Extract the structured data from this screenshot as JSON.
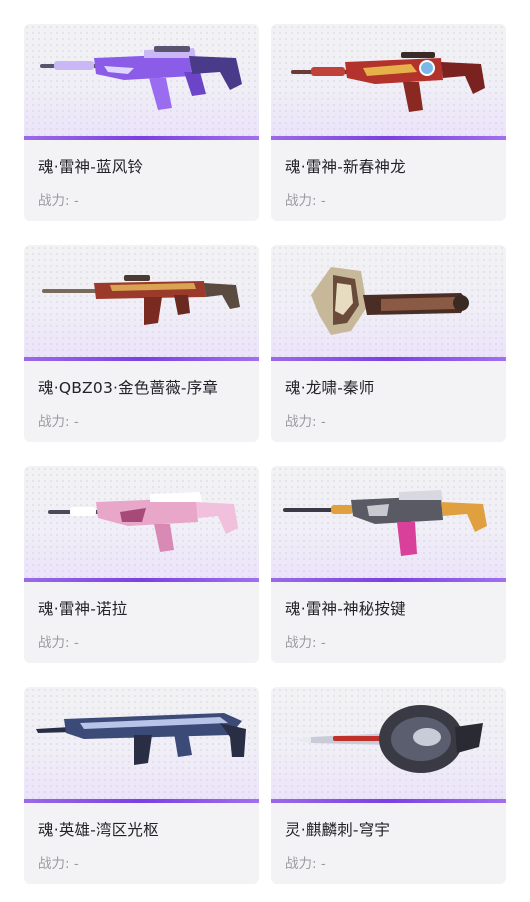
{
  "items": [
    {
      "name": "魂·雷神-蓝风铃",
      "power_label": "战力:",
      "power_value": "-",
      "colors": {
        "main": "#8a5ce8",
        "accent": "#c9b8f5",
        "barrel": "#5a5470"
      }
    },
    {
      "name": "魂·雷神-新春神龙",
      "power_label": "战力:",
      "power_value": "-",
      "colors": {
        "main": "#b4322c",
        "accent": "#e6b04a",
        "barrel": "#6a3a36"
      }
    },
    {
      "name": "魂·QBZ03·金色蔷薇-序章",
      "power_label": "战力:",
      "power_value": "-",
      "colors": {
        "main": "#9b3a2a",
        "accent": "#d8a454",
        "barrel": "#7a6a5a"
      }
    },
    {
      "name": "魂·龙啸-秦师",
      "power_label": "战力:",
      "power_value": "-",
      "colors": {
        "main": "#6a4a3a",
        "accent": "#c8b89a",
        "barrel": "#3a2a24"
      }
    },
    {
      "name": "魂·雷神-诺拉",
      "power_label": "战力:",
      "power_value": "-",
      "colors": {
        "main": "#e8a6c8",
        "accent": "#ffffff",
        "barrel": "#4a4a58"
      }
    },
    {
      "name": "魂·雷神-神秘按键",
      "power_label": "战力:",
      "power_value": "-",
      "colors": {
        "main": "#5a5a64",
        "accent": "#d8409a",
        "barrel": "#e0a040"
      }
    },
    {
      "name": "魂·英雄-湾区光枢",
      "power_label": "战力:",
      "power_value": "-",
      "colors": {
        "main": "#3c4a78",
        "accent": "#b8c4e8",
        "barrel": "#2a2e44"
      }
    },
    {
      "name": "灵·麒麟刺-穹宇",
      "power_label": "战力:",
      "power_value": "-",
      "colors": {
        "main": "#3a3a44",
        "accent": "#c8ccd8",
        "barrel": "#c0302a"
      }
    }
  ]
}
